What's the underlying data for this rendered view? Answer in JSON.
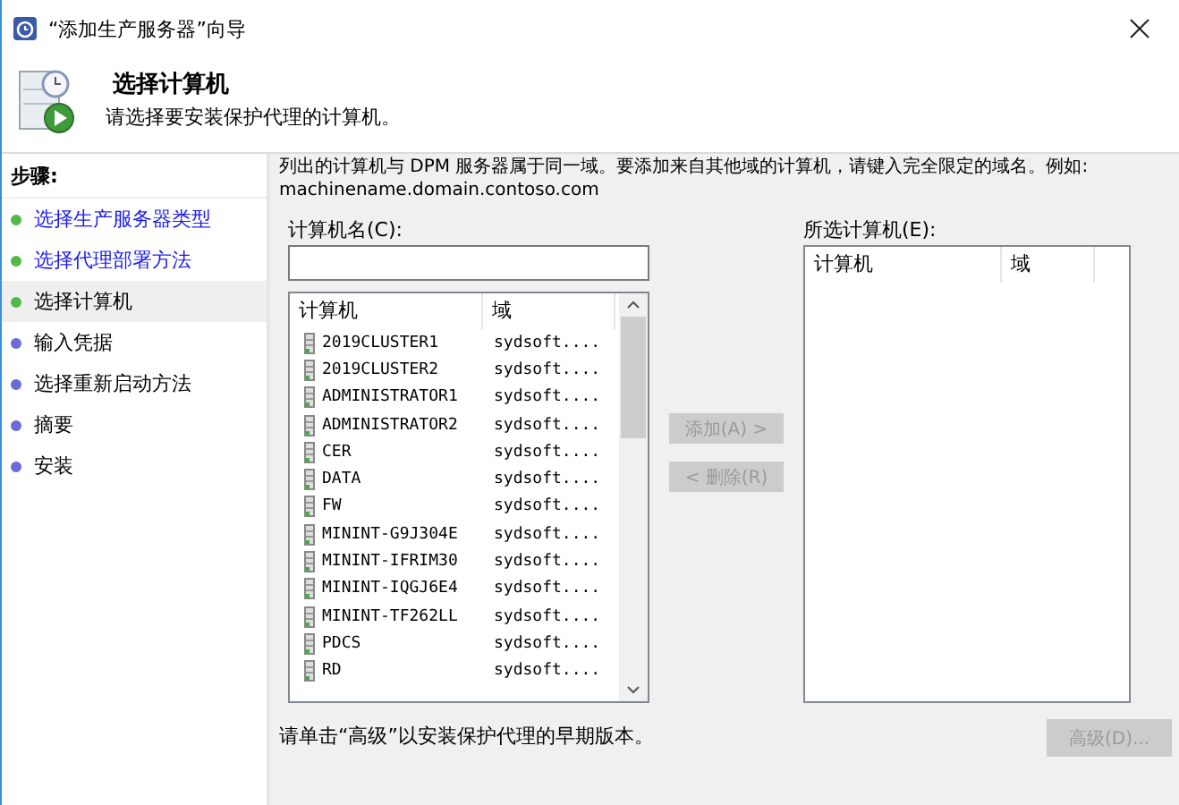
{
  "window": {
    "title": "“添加生产服务器”向导"
  },
  "header": {
    "title": "选择计算机",
    "subtitle": "请选择要安装保护代理的计算机。"
  },
  "steps": {
    "heading": "步骤:",
    "items": [
      {
        "label": "选择生产服务器类型",
        "done": true,
        "selected": false
      },
      {
        "label": "选择代理部署方法",
        "done": true,
        "selected": false
      },
      {
        "label": "选择计算机",
        "done": true,
        "selected": true
      },
      {
        "label": "输入凭据",
        "done": false,
        "selected": false
      },
      {
        "label": "选择重新启动方法",
        "done": false,
        "selected": false
      },
      {
        "label": "摘要",
        "done": false,
        "selected": false
      },
      {
        "label": "安装",
        "done": false,
        "selected": false
      }
    ]
  },
  "description": "列出的计算机与 DPM 服务器属于同一域。要添加来自其他域的计算机，请键入完全限定的域名。例如: machinename.domain.contoso.com",
  "computer_name": {
    "label": "计算机名(C):"
  },
  "available": {
    "columns": [
      "计算机",
      "域"
    ],
    "rows": [
      [
        "2019CLUSTER1",
        "sydsoft...."
      ],
      [
        "2019CLUSTER2",
        "sydsoft...."
      ],
      [
        "ADMINISTRATOR1",
        "sydsoft...."
      ],
      [
        "ADMINISTRATOR2",
        "sydsoft...."
      ],
      [
        "CER",
        "sydsoft...."
      ],
      [
        "DATA",
        "sydsoft...."
      ],
      [
        "FW",
        "sydsoft...."
      ],
      [
        "MININT-G9J304E",
        "sydsoft...."
      ],
      [
        "MININT-IFRIM30",
        "sydsoft...."
      ],
      [
        "MININT-IQGJ6E4",
        "sydsoft...."
      ],
      [
        "MININT-TF262LL",
        "sydsoft...."
      ],
      [
        "PDCS",
        "sydsoft...."
      ],
      [
        "RD",
        "sydsoft...."
      ]
    ]
  },
  "buttons": [
    {
      "label": "添加(A) >",
      "disabled": true
    },
    {
      "label": "< 删除(R)",
      "disabled": true
    }
  ],
  "selected_computers": {
    "label": "所选计算机(E):",
    "columns": [
      "计算机",
      "域"
    ]
  },
  "footer": {
    "text": "请单击“高级”以安装保护代理的早期版本。",
    "button": {
      "label": "高级(D)...",
      "disabled": true
    }
  }
}
